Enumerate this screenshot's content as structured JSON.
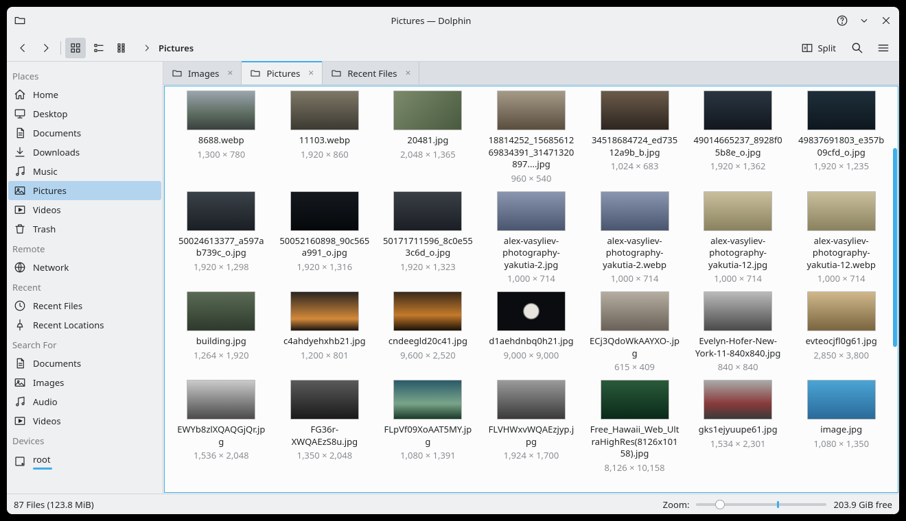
{
  "window": {
    "title": "Pictures — Dolphin"
  },
  "toolbar": {
    "split": "Split",
    "crumb": "Pictures"
  },
  "sidebar": {
    "headers": {
      "places": "Places",
      "remote": "Remote",
      "recent": "Recent",
      "search": "Search For",
      "devices": "Devices"
    },
    "places": [
      {
        "icon": "home",
        "label": "Home"
      },
      {
        "icon": "desktop",
        "label": "Desktop"
      },
      {
        "icon": "documents",
        "label": "Documents"
      },
      {
        "icon": "downloads",
        "label": "Downloads"
      },
      {
        "icon": "music",
        "label": "Music"
      },
      {
        "icon": "pictures",
        "label": "Pictures"
      },
      {
        "icon": "videos",
        "label": "Videos"
      },
      {
        "icon": "trash",
        "label": "Trash"
      }
    ],
    "remote": [
      {
        "icon": "network",
        "label": "Network"
      }
    ],
    "recent": [
      {
        "icon": "recent-files",
        "label": "Recent Files"
      },
      {
        "icon": "recent-locations",
        "label": "Recent Locations"
      }
    ],
    "search": [
      {
        "icon": "documents",
        "label": "Documents"
      },
      {
        "icon": "pictures",
        "label": "Images"
      },
      {
        "icon": "music",
        "label": "Audio"
      },
      {
        "icon": "videos",
        "label": "Videos"
      }
    ],
    "devices": [
      {
        "icon": "disk",
        "label": "root"
      }
    ]
  },
  "tabs": [
    {
      "label": "Images",
      "active": false
    },
    {
      "label": "Pictures",
      "active": true
    },
    {
      "label": "Recent Files",
      "active": false
    }
  ],
  "files": [
    {
      "name": "8688.webp",
      "dim": "1,300 × 780",
      "t": "a"
    },
    {
      "name": "11103.webp",
      "dim": "1,920 × 860",
      "t": "b"
    },
    {
      "name": "20481.jpg",
      "dim": "2,048 × 1,365",
      "t": "c"
    },
    {
      "name": "18814252_1568561269834391_31471320897....jpg",
      "dim": "960 × 540",
      "t": "d"
    },
    {
      "name": "34518684724_ed73512a9b_b.jpg",
      "dim": "1,024 × 683",
      "t": "e"
    },
    {
      "name": "49014665237_8928f05b8e_o.jpg",
      "dim": "1,920 × 1,362",
      "t": "f"
    },
    {
      "name": "49837691803_e357b09cfd_o.jpg",
      "dim": "1,920 × 1,235",
      "t": "g"
    },
    {
      "name": "50024613377_a597ab739c_o.jpg",
      "dim": "1,920 × 1,298",
      "t": "h"
    },
    {
      "name": "50052160898_90c565a991_o.jpg",
      "dim": "1,920 × 1,316",
      "t": "i"
    },
    {
      "name": "50171711596_8c0e553c6d_o.jpg",
      "dim": "1,920 × 1,323",
      "t": "j"
    },
    {
      "name": "alex-vasyliev-photography-yakutia-2.jpg",
      "dim": "1,000 × 714",
      "t": "k"
    },
    {
      "name": "alex-vasyliev-photography-yakutia-2.webp",
      "dim": "1,000 × 714",
      "t": "k"
    },
    {
      "name": "alex-vasyliev-photography-yakutia-12.jpg",
      "dim": "1,000 × 714",
      "t": "l"
    },
    {
      "name": "alex-vasyliev-photography-yakutia-12.webp",
      "dim": "1,000 × 714",
      "t": "l"
    },
    {
      "name": "building.jpg",
      "dim": "1,264 × 1,920",
      "t": "m"
    },
    {
      "name": "c4ahdyehxhb21.jpg",
      "dim": "1,200 × 801",
      "t": "n"
    },
    {
      "name": "cndeegld20c41.jpg",
      "dim": "9,600 × 2,520",
      "t": "o"
    },
    {
      "name": "d1aehdnbq0h21.jpg",
      "dim": "9,000 × 9,000",
      "t": "p"
    },
    {
      "name": "ECj3QdoWkAAYXO-.jpg",
      "dim": "615 × 409",
      "t": "q"
    },
    {
      "name": "Evelyn-Hofer-New-York-11-840x840.jpg",
      "dim": "840 × 840",
      "t": "r"
    },
    {
      "name": "evteocjfl0g61.jpg",
      "dim": "2,850 × 3,800",
      "t": "s"
    },
    {
      "name": "EWYb8zlXQAQGjQr.jpg",
      "dim": "1,536 × 2,048",
      "t": "t"
    },
    {
      "name": "FG36r-XWQAEzS8u.jpg",
      "dim": "1,350 × 2,048",
      "t": "u"
    },
    {
      "name": "FLpVf09XoAAT5MY.jpg",
      "dim": "1,080 × 1,391",
      "t": "v"
    },
    {
      "name": "FLVHWxvWQAEzjyp.jpg",
      "dim": "1,924 × 1,700",
      "t": "w"
    },
    {
      "name": "Free_Hawaii_Web_UltraHighRes(8126x10158).jpg",
      "dim": "8,126 × 10,158",
      "t": "x"
    },
    {
      "name": "gks1ejyuupe61.jpg",
      "dim": "1,534 × 2,301",
      "t": "y"
    },
    {
      "name": "image.jpg",
      "dim": "1,080 × 1,350",
      "t": "z"
    }
  ],
  "status": {
    "left": "87 Files (123.8 MiB)",
    "zoom_label": "Zoom:",
    "free": "203.9 GiB free"
  },
  "thumbs": {
    "a": "linear-gradient(180deg,#9aa5ad 0%,#5c6b5f 60%,#3a4140 100%)",
    "b": "linear-gradient(180deg,#7e7766 0%,#3c3a32 100%)",
    "c": "linear-gradient(135deg,#7a8a6a,#4a5a3f)",
    "d": "linear-gradient(180deg,#a59a87,#5a4e3f)",
    "e": "linear-gradient(180deg,#6b5a4a,#2e2620)",
    "f": "linear-gradient(180deg,#2a3542,#12171e)",
    "g": "linear-gradient(180deg,#1e2f3a,#0e171f)",
    "h": "linear-gradient(180deg,#3a4148,#1a1f24)",
    "i": "linear-gradient(180deg,#15191e,#05080b)",
    "j": "linear-gradient(180deg,#3a3f46,#1b1f25)",
    "k": "linear-gradient(180deg,#8a95b0,#4a5570)",
    "l": "linear-gradient(180deg,#cabf9d,#8a825f)",
    "m": "linear-gradient(180deg,#5a6a55,#2e3a2c)",
    "n": "linear-gradient(180deg,#2a2520,#d48a3a 70%,#1a1410)",
    "o": "linear-gradient(180deg,#3a2a1a,#c47a2a 60%,#1a1208)",
    "p": "radial-gradient(circle,#e8e5df 18%,#0a0c10 22%)",
    "q": "linear-gradient(180deg,#b5ada0,#6a6258)",
    "r": "linear-gradient(180deg,#bababa,#4a4a4a)",
    "s": "linear-gradient(180deg,#d0b88a,#7a6540)",
    "t": "linear-gradient(180deg,#cacaca,#4a4a4a)",
    "u": "linear-gradient(180deg,#5a5a5a,#1a1a1a)",
    "v": "linear-gradient(180deg,#2a5a6a,#7aa58a 60%,#1a3a2a)",
    "w": "linear-gradient(180deg,#9a9a9a,#3a3a3a)",
    "x": "linear-gradient(180deg,#2a5a3a,#0a2a1a)",
    "y": "linear-gradient(180deg,#aaa,#8a3a3a 60%,#3a3a3a)",
    "z": "linear-gradient(180deg,#4aa5d5,#2a6a9a)"
  }
}
